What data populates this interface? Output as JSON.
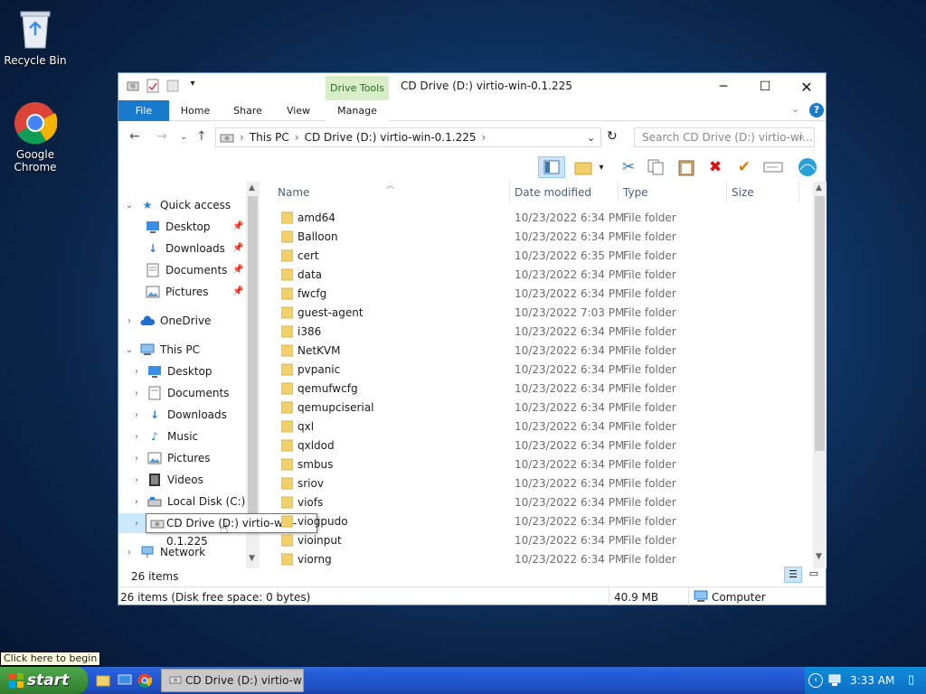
{
  "desktop": {
    "recycle_bin": "Recycle Bin",
    "chrome": "Google Chrome"
  },
  "window": {
    "title": "CD Drive (D:) virtio-win-0.1.225",
    "context_tab": "Drive Tools",
    "tabs": [
      "File",
      "Home",
      "Share",
      "View",
      "Manage"
    ],
    "address": {
      "segments": [
        "This PC",
        "CD Drive (D:) virtio-win-0.1.225"
      ]
    },
    "search_placeholder": "Search CD Drive (D:) virtio-wi...",
    "columns": {
      "name": "Name",
      "date": "Date modified",
      "type": "Type",
      "size": "Size"
    },
    "files": [
      {
        "name": "amd64",
        "date": "10/23/2022 6:34 PM",
        "type": "File folder"
      },
      {
        "name": "Balloon",
        "date": "10/23/2022 6:34 PM",
        "type": "File folder"
      },
      {
        "name": "cert",
        "date": "10/23/2022 6:35 PM",
        "type": "File folder"
      },
      {
        "name": "data",
        "date": "10/23/2022 6:34 PM",
        "type": "File folder"
      },
      {
        "name": "fwcfg",
        "date": "10/23/2022 6:34 PM",
        "type": "File folder"
      },
      {
        "name": "guest-agent",
        "date": "10/23/2022 7:03 PM",
        "type": "File folder"
      },
      {
        "name": "i386",
        "date": "10/23/2022 6:34 PM",
        "type": "File folder"
      },
      {
        "name": "NetKVM",
        "date": "10/23/2022 6:34 PM",
        "type": "File folder"
      },
      {
        "name": "pvpanic",
        "date": "10/23/2022 6:34 PM",
        "type": "File folder"
      },
      {
        "name": "qemufwcfg",
        "date": "10/23/2022 6:34 PM",
        "type": "File folder"
      },
      {
        "name": "qemupciserial",
        "date": "10/23/2022 6:34 PM",
        "type": "File folder"
      },
      {
        "name": "qxl",
        "date": "10/23/2022 6:34 PM",
        "type": "File folder"
      },
      {
        "name": "qxldod",
        "date": "10/23/2022 6:34 PM",
        "type": "File folder"
      },
      {
        "name": "smbus",
        "date": "10/23/2022 6:34 PM",
        "type": "File folder"
      },
      {
        "name": "sriov",
        "date": "10/23/2022 6:34 PM",
        "type": "File folder"
      },
      {
        "name": "viofs",
        "date": "10/23/2022 6:34 PM",
        "type": "File folder"
      },
      {
        "name": "viogpudo",
        "date": "10/23/2022 6:34 PM",
        "type": "File folder"
      },
      {
        "name": "vioinput",
        "date": "10/23/2022 6:34 PM",
        "type": "File folder"
      },
      {
        "name": "viorng",
        "date": "10/23/2022 6:34 PM",
        "type": "File folder"
      }
    ],
    "nav": {
      "quick_access": "Quick access",
      "qa_desktop": "Desktop",
      "qa_downloads": "Downloads",
      "qa_documents": "Documents",
      "qa_pictures": "Pictures",
      "onedrive": "OneDrive",
      "this_pc": "This PC",
      "pc_desktop": "Desktop",
      "pc_documents": "Documents",
      "pc_downloads": "Downloads",
      "pc_music": "Music",
      "pc_pictures": "Pictures",
      "pc_videos": "Videos",
      "local_disk": "Local Disk (C:)",
      "network": "Network"
    },
    "tooltip": "CD Drive (D:) virtio-win-0.1.225",
    "item_count": "26 items",
    "status": {
      "left": "26 items (Disk free space: 0 bytes)",
      "size": "40.9 MB",
      "location": "Computer"
    }
  },
  "taskbar": {
    "begin_tip": "Click here to begin",
    "start": "start",
    "task_button": "CD Drive (D:) virtio-wi...",
    "clock": "3:33 AM"
  }
}
